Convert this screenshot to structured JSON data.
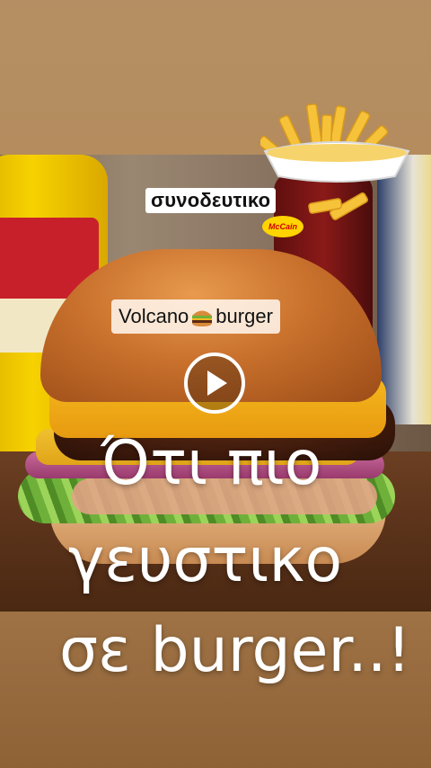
{
  "overlay": {
    "side_caption": "συνοδευτικο",
    "brand_badge": "McCain",
    "title_before": "Volcano",
    "title_after": "burger",
    "title_icon": "burger-emoji-icon",
    "headline_line1": "Ότι πιο",
    "headline_line2": "γευστικο",
    "headline_line3": "σε burger..!"
  },
  "player": {
    "play_icon": "play-icon"
  },
  "colors": {
    "caption_bg": "#ffffff",
    "headline_text": "#ffffff",
    "play_ring": "#ffffff",
    "bun": "#c8702c",
    "cheese": "#f5b81e"
  }
}
